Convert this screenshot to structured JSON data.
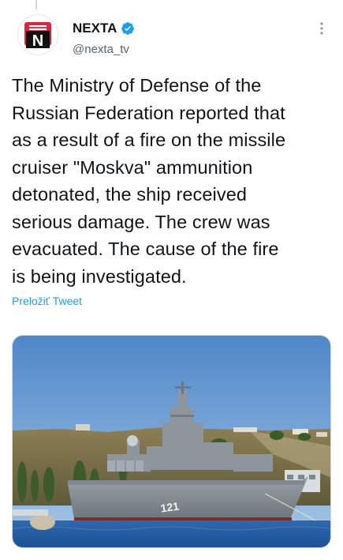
{
  "tweet": {
    "display_name": "NEXTA",
    "handle": "@nexta_tv",
    "avatar_letter": "N",
    "text": "The Ministry of Defense of the\nRussian Federation reported that\nas a result of a fire on the missile\ncruiser \"Moskva\" ammunition\ndetonated, the ship received\nserious damage. The crew was\nevacuated. The cause of the fire\nis being investigated.",
    "translate_label": "Preložiť Tweet",
    "ship_hull_number": "121"
  },
  "colors": {
    "accent": "#1d9bf0",
    "verified": "#1d9bf0",
    "avatar_red": "#d7263d",
    "text": "#0f1419",
    "secondary": "#536471"
  },
  "icons": {
    "verified": "verified-badge-icon",
    "more": "more-options-icon"
  }
}
